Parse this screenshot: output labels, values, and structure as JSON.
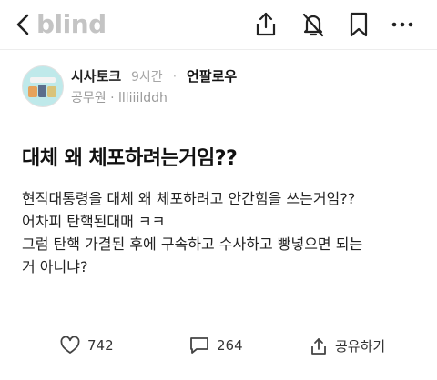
{
  "header": {
    "logo": "blind",
    "icons": [
      "back-icon",
      "share-icon",
      "notification-off-icon",
      "bookmark-icon",
      "more-icon"
    ]
  },
  "post": {
    "channel": "시사토크",
    "time": "9시간",
    "follow_label": "언팔로우",
    "job": "공무원",
    "nickname": "llliiilddh",
    "title": "대체 왜 체포하려는거임??",
    "body_lines": [
      "현직대통령을 대체 왜 체포하려고 안간힘을 쓰는거임??",
      "어차피 탄핵된대매 ㅋㅋ",
      "그럼 탄핵 가결된 후에 구속하고 수사하고 빵넣으면 되는",
      "거 아니냐?"
    ]
  },
  "actions": {
    "likes": "742",
    "comments": "264",
    "share_label": "공유하기"
  },
  "colors": {
    "logo": "#c4c4c4",
    "meta": "#9a9a9a",
    "avatar_bg": "#bfe9ea"
  }
}
